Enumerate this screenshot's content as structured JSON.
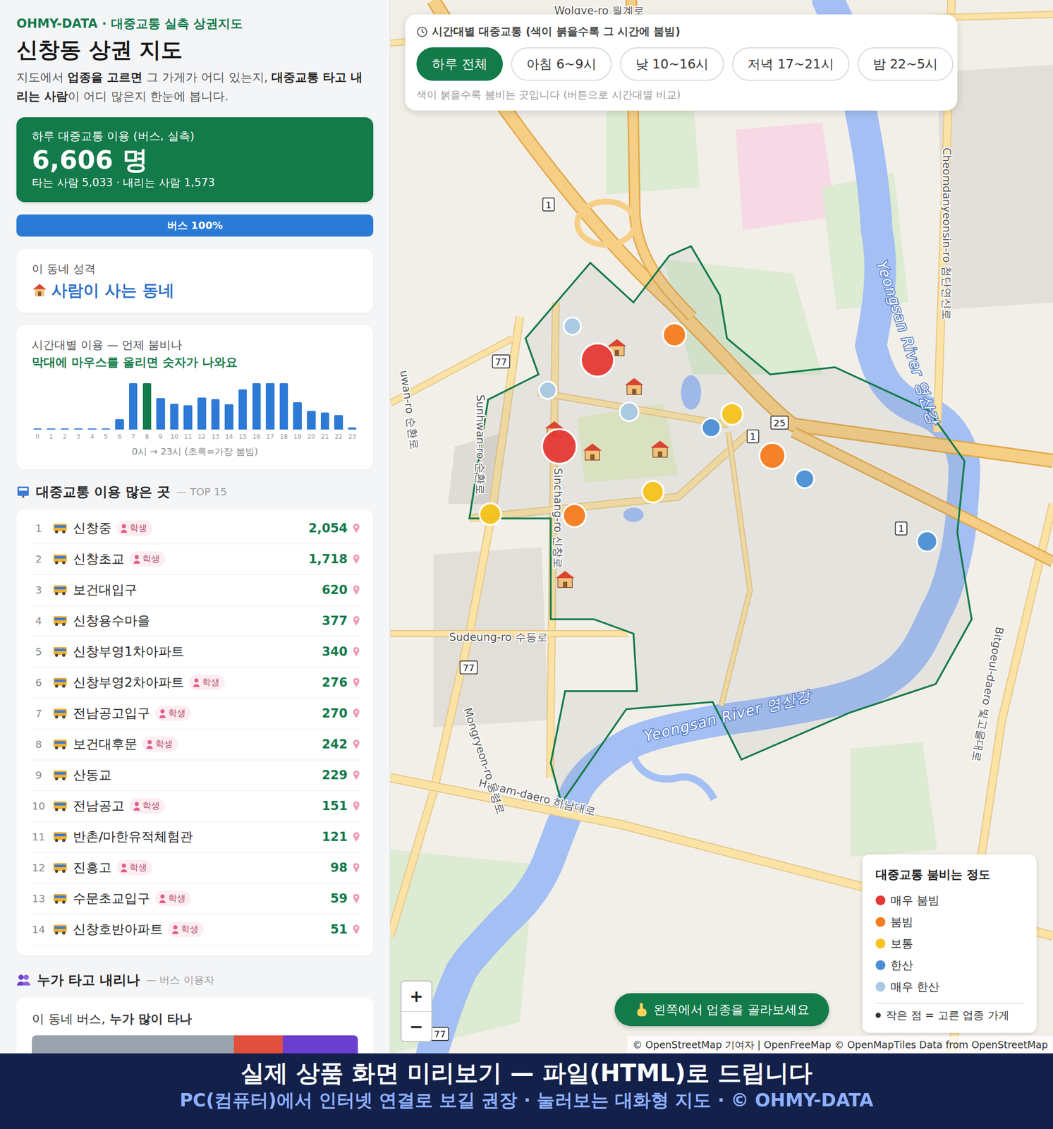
{
  "brand": "OHMY-DATA · 대중교통 실측 상권지도",
  "title": "신창동 상권 지도",
  "description": [
    {
      "text": "지도에서 ",
      "bold": false
    },
    {
      "text": "업종을 고르면",
      "bold": true
    },
    {
      "text": " 그 가게가 어디 있는지, ",
      "bold": false
    },
    {
      "text": "대중교통 타고 내리는 사람",
      "bold": true
    },
    {
      "text": "이 어디 많은지 한눈에 봅니다.",
      "bold": false
    }
  ],
  "summary": {
    "label": "하루 대중교통 이용 (버스, 실측)",
    "total": "6,606 명",
    "detail": "타는 사람 5,033 · 내리는 사람 1,573"
  },
  "mode_share": [
    {
      "label": "버스 100%",
      "level": 1,
      "color": "#2b7bd6"
    }
  ],
  "character": {
    "label": "이 동네 성격",
    "value": "사람이 사는 동네"
  },
  "hourly": {
    "title": "시간대별 이용 — 언제 붐비나",
    "hint": "막대에 마우스를 올리면 숫자가 나와요",
    "values": [
      10,
      9,
      8,
      8,
      9,
      12,
      120,
      560,
      565,
      380,
      310,
      295,
      385,
      370,
      305,
      490,
      560,
      560,
      560,
      330,
      225,
      205,
      170,
      20
    ],
    "ticks": [
      "0",
      "1",
      "2",
      "3",
      "4",
      "5",
      "6",
      "7",
      "8",
      "9",
      "10",
      "11",
      "12",
      "13",
      "14",
      "15",
      "16",
      "17",
      "18",
      "19",
      "20",
      "21",
      "22",
      "23"
    ],
    "caption": "0시 → 23시 (초록=가장 붐빔)"
  },
  "top_stops": {
    "title": "대중교통 이용 많은 곳",
    "subtitle": "— TOP 15",
    "badge_label": "학생",
    "items": [
      {
        "rank": "1",
        "name": "신창중",
        "student": true,
        "count": "2,054"
      },
      {
        "rank": "2",
        "name": "신창초교",
        "student": true,
        "count": "1,718"
      },
      {
        "rank": "3",
        "name": "보건대입구",
        "student": false,
        "count": "620"
      },
      {
        "rank": "4",
        "name": "신창용수마을",
        "student": false,
        "count": "377"
      },
      {
        "rank": "5",
        "name": "신창부영1차아파트",
        "student": false,
        "count": "340"
      },
      {
        "rank": "6",
        "name": "신창부영2차아파트",
        "student": true,
        "count": "276"
      },
      {
        "rank": "7",
        "name": "전남공고입구",
        "student": true,
        "count": "270"
      },
      {
        "rank": "8",
        "name": "보건대후문",
        "student": true,
        "count": "242"
      },
      {
        "rank": "9",
        "name": "산동교",
        "student": false,
        "count": "229"
      },
      {
        "rank": "10",
        "name": "전남공고",
        "student": true,
        "count": "151"
      },
      {
        "rank": "11",
        "name": "반촌/마한유적체험관",
        "student": false,
        "count": "121"
      },
      {
        "rank": "12",
        "name": "진흥고",
        "student": true,
        "count": "98"
      },
      {
        "rank": "13",
        "name": "수문초교입구",
        "student": true,
        "count": "59"
      },
      {
        "rank": "14",
        "name": "신창호반아파트",
        "student": true,
        "count": "51"
      }
    ]
  },
  "riders": {
    "title": "누가 타고 내리나",
    "subtitle": "— 버스 이용자",
    "card_lead": "이 동네 버스, ",
    "card_bold": "누가 많이 타나",
    "bar": [
      {
        "level": 0.62,
        "color": "#9aa3ad"
      },
      {
        "level": 0.15,
        "color": "#e0503c"
      },
      {
        "level": 0.23,
        "color": "#6a3fd0"
      }
    ]
  },
  "time_filter": {
    "title": "시간대별 대중교통 (색이 붉을수록 그 시간에 붐빔)",
    "buttons": [
      {
        "label": "하루 전체",
        "selected": true
      },
      {
        "label": "아침 6~9시",
        "selected": false
      },
      {
        "label": "낮 10~16시",
        "selected": false
      },
      {
        "label": "저녁 17~21시",
        "selected": false
      },
      {
        "label": "밤 22~5시",
        "selected": false
      }
    ],
    "note": "색이 붉을수록 붐비는 곳입니다 (버튼으로 시간대별 비교)"
  },
  "map": {
    "labels": [
      {
        "text": "Wolgye-ro 월계로"
      },
      {
        "text": "Sudeung-ro 수등로"
      },
      {
        "text": "Yeongsan River 영산강"
      },
      {
        "text": "Yeongsan River 영산강"
      },
      {
        "text": "Cheomdanyeonsin-ro 첨단연신로"
      },
      {
        "text": "Sunhwan-ro 순환로"
      },
      {
        "text": "Sinchang-ro 신창로"
      },
      {
        "text": "Hanam-daero 하남대로"
      },
      {
        "text": "Bitgoeul-daero 빛고을대로"
      },
      {
        "text": "Mongryeon-ro 몽령로"
      },
      {
        "text": "uwan-ro 순환로"
      }
    ],
    "shields": [
      "1",
      "1",
      "1",
      "77",
      "77",
      "77",
      "25"
    ],
    "stops": [
      {
        "color": "#e53935"
      },
      {
        "color": "#e53935"
      },
      {
        "color": "#f57c1f"
      },
      {
        "color": "#f57c1f"
      },
      {
        "color": "#f57c1f"
      },
      {
        "color": "#f6c31c"
      },
      {
        "color": "#f6c31c"
      },
      {
        "color": "#f6c31c"
      },
      {
        "color": "#4a8fd4"
      },
      {
        "color": "#4a8fd4"
      },
      {
        "color": "#4a8fd4"
      },
      {
        "color": "#a8c8e4"
      },
      {
        "color": "#a8c8e4"
      },
      {
        "color": "#a8c8e4"
      }
    ],
    "zoom": [
      "+",
      "−"
    ],
    "prompt": "왼쪽에서 업종을 골라보세요",
    "attribution": "© OpenStreetMap 기여자 | OpenFreeMap © OpenMapTiles Data from OpenStreetMap"
  },
  "legend": {
    "title": "대중교통 붐비는 정도",
    "items": [
      {
        "label": "매우 붐빔",
        "color": "#e53935"
      },
      {
        "label": "붐빔",
        "color": "#f57c1f"
      },
      {
        "label": "보통",
        "color": "#f6c31c"
      },
      {
        "label": "한산",
        "color": "#4a8fd4"
      },
      {
        "label": "매우 한산",
        "color": "#a8c8e4"
      }
    ],
    "note": "작은 점 = 고른 업종 가게"
  },
  "banner": {
    "line1": "실제 상품 화면 미리보기 — 파일(HTML)로 드립니다",
    "line2": "PC(컴퓨터)에서 인터넷 연결로 보길 권장 · 눌러보는 대화형 지도 · © OHMY-DATA"
  }
}
